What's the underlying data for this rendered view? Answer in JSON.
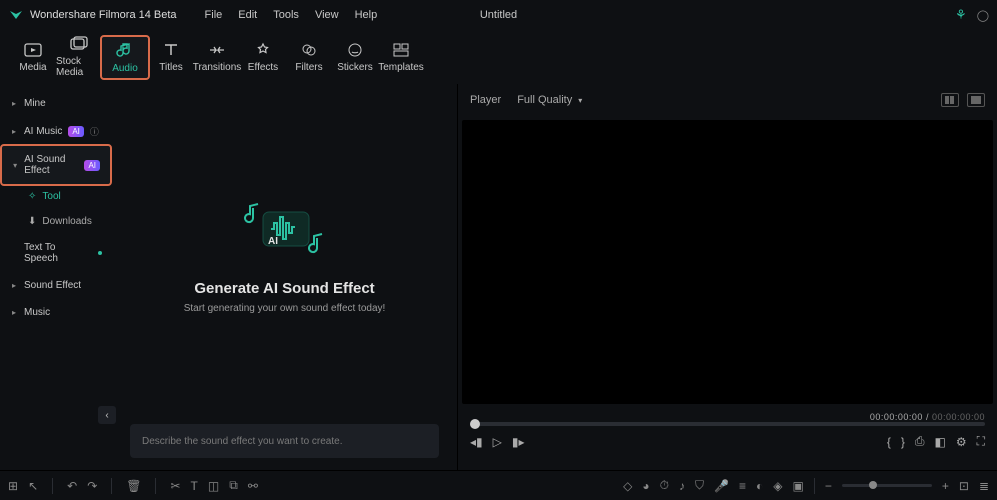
{
  "app": {
    "name": "Wondershare Filmora 14 Beta",
    "doc_title": "Untitled"
  },
  "menu": {
    "file": "File",
    "edit": "Edit",
    "tools": "Tools",
    "view": "View",
    "help": "Help"
  },
  "tabs": {
    "media": "Media",
    "stock": "Stock Media",
    "audio": "Audio",
    "titles": "Titles",
    "transitions": "Transitions",
    "effects": "Effects",
    "filters": "Filters",
    "stickers": "Stickers",
    "templates": "Templates"
  },
  "sidebar": {
    "mine": "Mine",
    "ai_music": "AI Music",
    "ai_sound": "AI Sound Effect",
    "tool": "Tool",
    "downloads": "Downloads",
    "tts": "Text To Speech",
    "sfx": "Sound Effect",
    "music": "Music",
    "ai_badge": "AI"
  },
  "center": {
    "title": "Generate AI Sound Effect",
    "subtitle": "Start generating your own sound effect today!",
    "prompt_placeholder": "Describe the sound effect you want to create."
  },
  "player": {
    "label": "Player",
    "quality": "Full Quality",
    "time_current": "00:00:00:00",
    "time_total": "00:00:00:00"
  }
}
